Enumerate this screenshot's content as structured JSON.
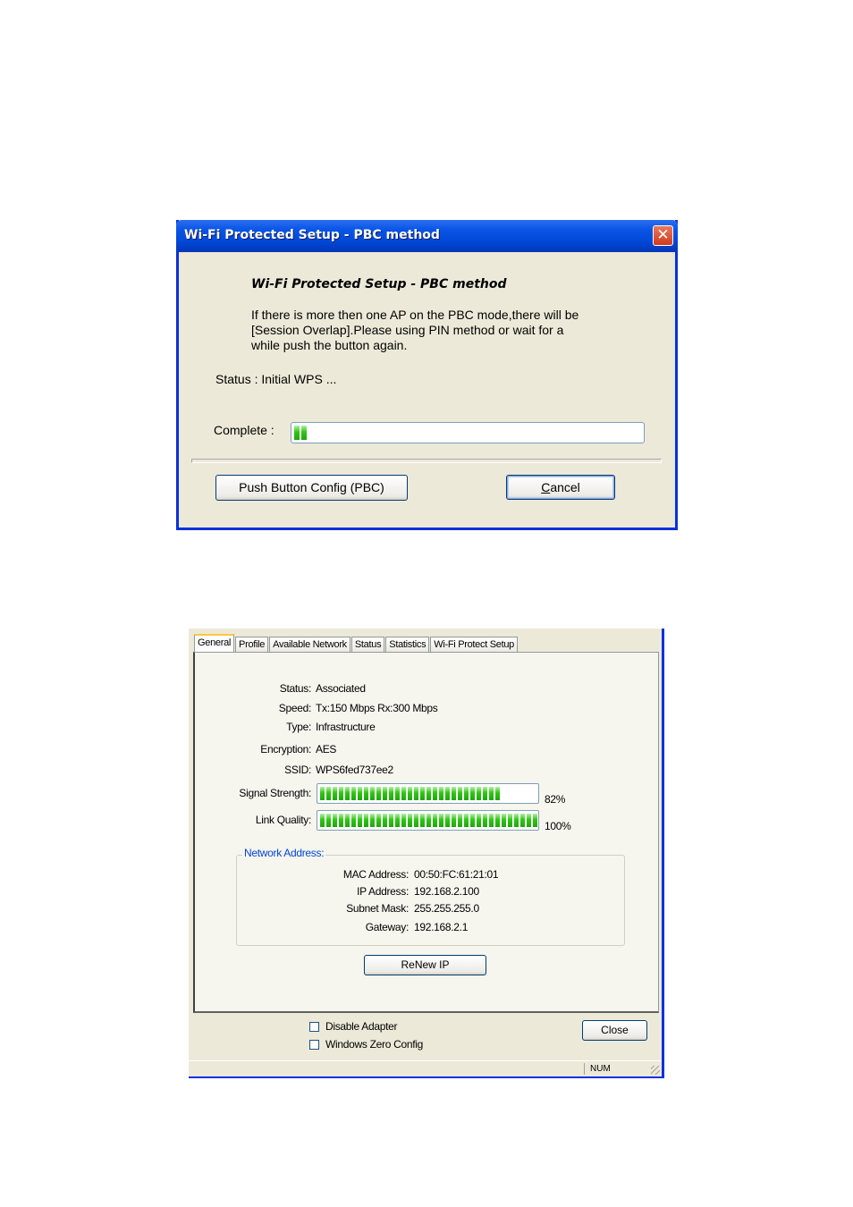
{
  "wps_dialog": {
    "title": "Wi-Fi Protected Setup - PBC method",
    "close_glyph": "✕",
    "heading": "Wi-Fi Protected Setup - PBC method",
    "message_lines": [
      "If there is more then one AP on the PBC mode,there will be",
      "[Session Overlap].Please using PIN method or wait for a",
      "while push the button again."
    ],
    "status_text": "Status : Initial WPS ...",
    "complete_label": "Complete :",
    "progress_fraction": 0.05,
    "pbc_button": "Push Button Config (PBC)",
    "cancel_button": "Cancel",
    "colors": {
      "title_blue": "#0046d5",
      "progress_green": "#32c517",
      "face": "#ece9d8"
    }
  },
  "utility": {
    "tabs": [
      "General",
      "Profile",
      "Available Network",
      "Status",
      "Statistics",
      "Wi-Fi Protect Setup"
    ],
    "active_tab": "General",
    "general": {
      "status_label": "Status:",
      "status_value": "Associated",
      "speed_label": "Speed:",
      "speed_value": "Tx:150 Mbps Rx:300 Mbps",
      "type_label": "Type:",
      "type_value": "Infrastructure",
      "encryption_label": "Encryption:",
      "encryption_value": "AES",
      "ssid_label": "SSID:",
      "ssid_value": "WPS6fed737ee2",
      "signal_label": "Signal Strength:",
      "signal_percent": 82,
      "signal_text": "82%",
      "link_label": "Link Quality:",
      "link_percent": 100,
      "link_text": "100%"
    },
    "network_address": {
      "title": "Network Address:",
      "mac_label": "MAC Address:",
      "mac_value": "00:50:FC:61:21:01",
      "ip_label": "IP Address:",
      "ip_value": "192.168.2.100",
      "subnet_label": "Subnet Mask:",
      "subnet_value": "255.255.255.0",
      "gateway_label": "Gateway:",
      "gateway_value": "192.168.2.1"
    },
    "renew_button": "ReNew IP",
    "disable_adapter": "Disable Adapter",
    "windows_zero_config": "Windows Zero Config",
    "close_button": "Close",
    "statusbar_num": "NUM"
  }
}
